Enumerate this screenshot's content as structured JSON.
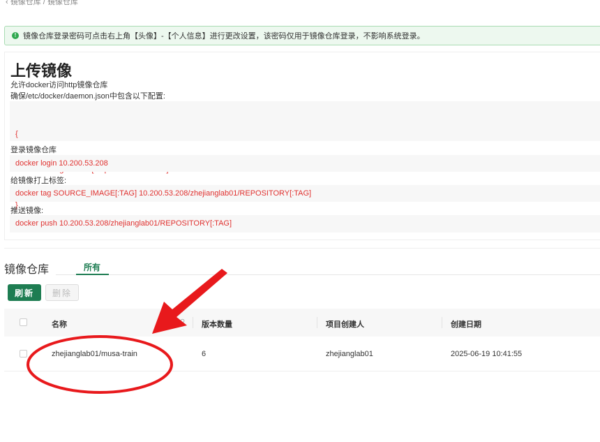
{
  "breadcrumb": {
    "parent": "镜像仓库",
    "current": "镜像仓库"
  },
  "alert": {
    "text": "镜像仓库登录密码可点击右上角【头像】-【个人信息】进行更改设置，该密码仅用于镜像仓库登录，不影响系统登录。"
  },
  "upload": {
    "title": "上传镜像",
    "allow_http": "允许docker访问http镜像仓库",
    "daemon_hint": "确保/etc/docker/daemon.json中包含以下配置:",
    "daemon_code": [
      "{",
      "  'insecure-registries' : [ http://10.200.53.208 ]",
      "}"
    ],
    "login_label": "登录镜像仓库",
    "login_cmd": "docker login 10.200.53.208",
    "tag_label": "给镜像打上标签:",
    "tag_cmd": "docker tag SOURCE_IMAGE[:TAG] 10.200.53.208/zhejianglab01/REPOSITORY[:TAG]",
    "push_label": "推送镜像:",
    "push_cmd": "docker push 10.200.53.208/zhejianglab01/REPOSITORY[:TAG]"
  },
  "repo": {
    "title": "镜像仓库",
    "tabs": [
      {
        "label": "所有",
        "active": true
      }
    ],
    "refresh_label": "刷新",
    "delete_label": "删除",
    "columns": [
      "名称",
      "版本数量",
      "项目创建人",
      "创建日期"
    ],
    "rows": [
      {
        "name": "zhejianglab01/musa-train",
        "versions": "6",
        "creator": "zhejianglab01",
        "created": "2025-06-19 10:41:55"
      }
    ]
  },
  "colors": {
    "accent": "#1e7d52",
    "code": "#e0312f",
    "annotation": "#e8191c",
    "alert_bg": "#edf8ef"
  },
  "icons": {
    "alert": "info-circle-icon",
    "back": "chevron-left-icon",
    "column_search": "search-icon"
  }
}
